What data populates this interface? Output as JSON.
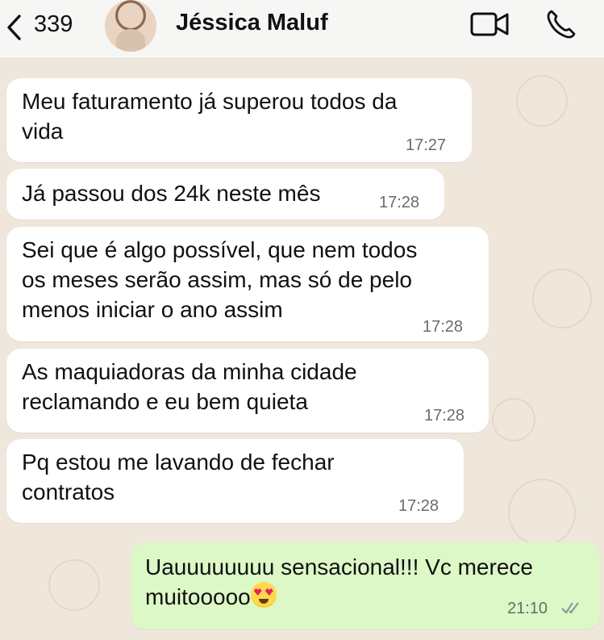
{
  "header": {
    "back_count": "339",
    "contact_name": "Jéssica Maluf",
    "icons": [
      "chevron-left-icon",
      "avatar",
      "video-call-icon",
      "phone-call-icon"
    ]
  },
  "messages": [
    {
      "direction": "in",
      "lines": [
        "Meu faturamento já superou todos da",
        "vida"
      ],
      "time": "17:27"
    },
    {
      "direction": "in",
      "lines": [
        "Já passou dos 24k neste mês"
      ],
      "time": "17:28"
    },
    {
      "direction": "in",
      "lines": [
        "Sei que é algo possível, que nem todos",
        "os meses serão assim, mas só de pelo",
        "menos iniciar o ano assim"
      ],
      "time": "17:28"
    },
    {
      "direction": "in",
      "lines": [
        "As maquiadoras da minha cidade",
        "reclamando e eu bem quieta"
      ],
      "time": "17:28"
    },
    {
      "direction": "in",
      "lines": [
        "Pq estou me lavando de fechar",
        "contratos"
      ],
      "time": "17:28"
    },
    {
      "direction": "out",
      "lines": [
        "Uauuuuuuuu sensacional!!! Vc merece",
        "muitooooo"
      ],
      "time": "21:10",
      "emoji": "heart-eyes-emoji",
      "status": "read"
    }
  ],
  "colors": {
    "incoming_bubble": "#ffffff",
    "outgoing_bubble": "#dcf8c6",
    "chat_background": "#efe7dc",
    "read_check": "#8a8f93"
  }
}
